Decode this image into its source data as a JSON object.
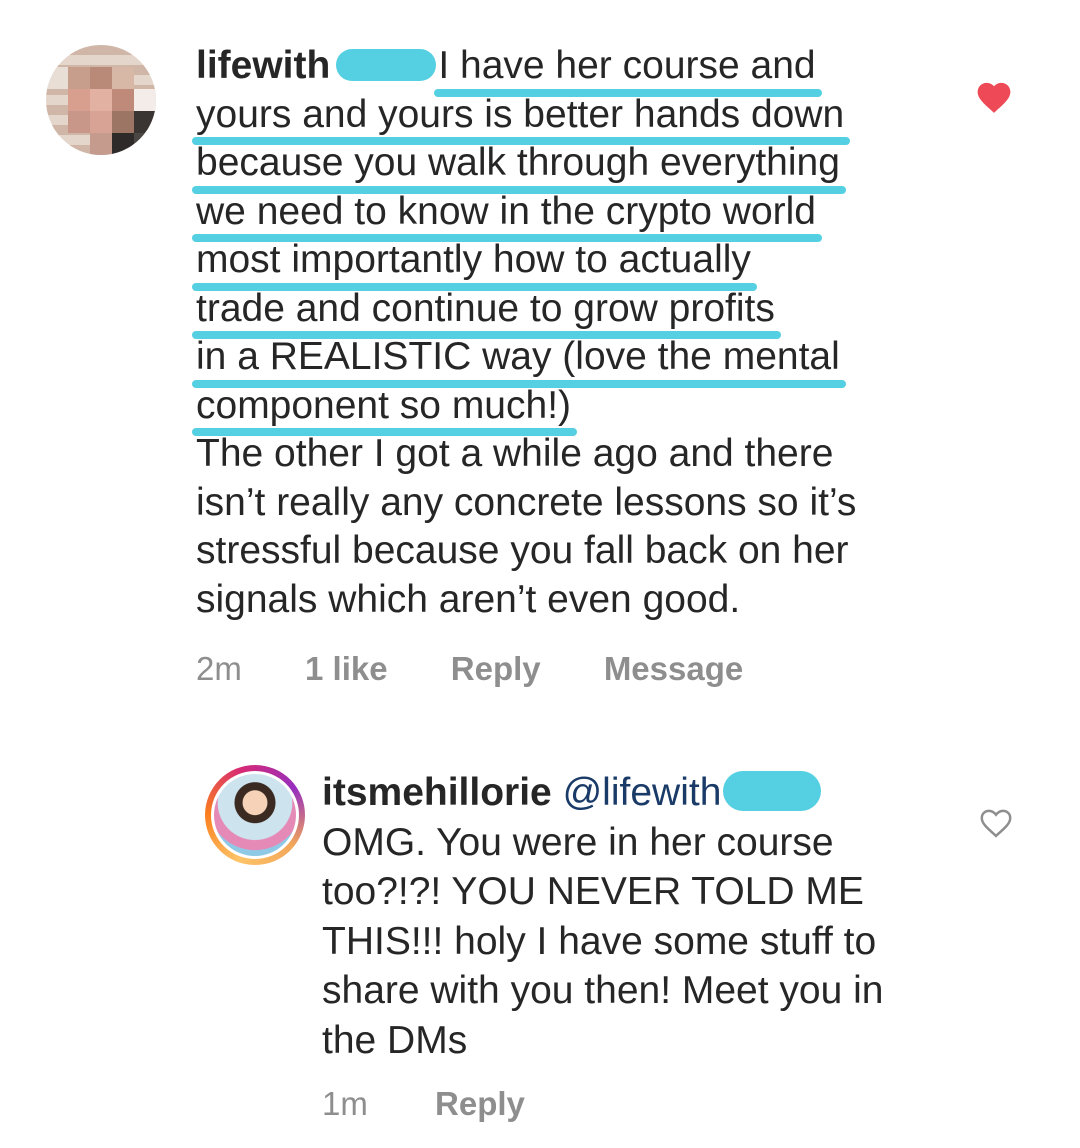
{
  "comments": [
    {
      "username": "lifewith",
      "highlighted_lines": [
        "I have her course and",
        "yours and yours is better hands down",
        "because you walk through everything",
        "we need to know in the crypto world",
        "most importantly how to actually",
        "trade and continue to grow profits",
        "in a REALISTIC way (love the mental",
        "component so much!)"
      ],
      "plain_lines": [
        "The other I got a while ago and there",
        "isn’t really any concrete lessons so it’s",
        "stressful because you fall back on her",
        "signals which aren’t even good."
      ],
      "time": "2m",
      "likes": "1 like",
      "reply_label": "Reply",
      "message_label": "Message",
      "liked": true
    },
    {
      "username": "itsmehillorie",
      "mention": "@lifewith",
      "lines": [
        "OMG. You were in her course",
        "too?!?! YOU NEVER TOLD ME",
        "THIS!!! holy I have some stuff to",
        "share with you then! Meet you in",
        "the DMs"
      ],
      "time": "1m",
      "reply_label": "Reply",
      "liked": false
    }
  ],
  "colors": {
    "highlight": "#55d0e2",
    "heart_liked": "#ed4956",
    "meta_text": "#8e8e8e",
    "mention": "#1a3a68"
  },
  "icons": {
    "like_filled": "heart-filled-icon",
    "like_outline": "heart-outline-icon"
  }
}
